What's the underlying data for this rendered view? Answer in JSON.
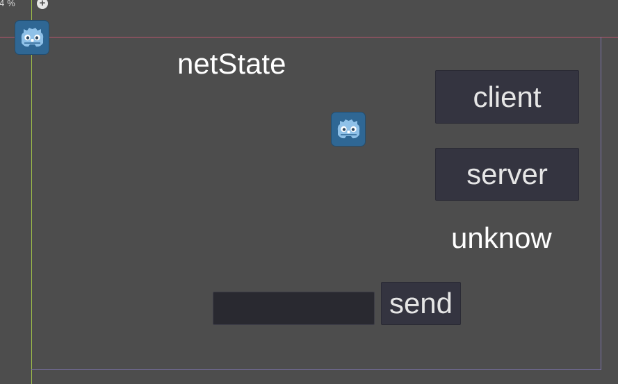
{
  "editor": {
    "zoom_text": "4 %",
    "zoom_in_icon": "plus-circle-icon"
  },
  "scene": {
    "title_label": "netState",
    "client_button": "client",
    "server_button": "server",
    "status_label": "unknow",
    "send_button": "send",
    "message_input": {
      "value": "",
      "placeholder": ""
    },
    "node_icon": "godot-icon"
  },
  "colors": {
    "background": "#4d4d4d",
    "button_bg": "#343440",
    "input_bg": "#292930",
    "guide_vertical": "#9fbf49",
    "guide_horizontal": "#b9556d",
    "frame_border": "#7a72a8",
    "icon_bg": "#2f6794"
  }
}
